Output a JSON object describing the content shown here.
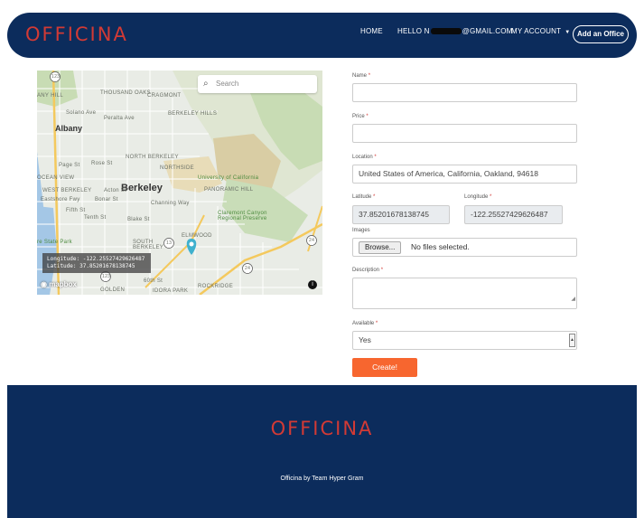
{
  "nav": {
    "brand": "OFFICINA",
    "home": "HOME",
    "hello_prefix": "HELLO N",
    "hello_suffix": "@GMAIL.COM",
    "my_account": "MY ACCOUNT",
    "add_office": "Add an Office"
  },
  "map": {
    "search_placeholder": "Search",
    "longitude_readout": "Longitude: -122.25527429626487",
    "latitude_readout": "Latitude: 37.85201678138745",
    "attribution_logo": "mapbox",
    "labels": {
      "berkeley": "Berkeley",
      "albany": "Albany",
      "north_berkeley": "NORTH BERKELEY",
      "northside": "NORTHSIDE",
      "thousand_oaks": "THOUSAND OAKS",
      "cragmont": "CRAGMONT",
      "berkeley_hills": "BERKELEY HILLS",
      "university": "University of California",
      "panoramic_hill": "PANORAMIC HILL",
      "claremont_canyon": "Claremont Canyon Regional Preserve",
      "west_berkeley": "WEST BERKELEY",
      "ocean_view": "OCEAN VIEW",
      "south_berkeley": "SOUTH BERKELEY",
      "elmwood": "ELMWOOD",
      "rockridge": "ROCKRIDGE",
      "golden": "GOLDEN",
      "idora_park": "IDORA PARK",
      "state_park": "re State Park",
      "any_hill": "ANY HILL",
      "solano_ave": "Solano Ave",
      "page_st": "Page St",
      "rose_st": "Rose St",
      "channing_way": "Channing Way",
      "blake_st": "Blake St",
      "sixtieth_st": "60th St",
      "fifth_st": "Fifth St",
      "tenth_st": "Tenth St",
      "bonar_st": "Bonar St",
      "acton_st": "Acton St",
      "eastshore_fwy": "Eastshore Fwy",
      "peralta_ave": "Peralta Ave",
      "route_123a": "123",
      "route_123b": "123",
      "route_13": "13",
      "route_24a": "24",
      "route_24b": "24"
    }
  },
  "form": {
    "name_label": "Name",
    "price_label": "Price",
    "location_label": "Location",
    "location_value": "United States of America, California, Oakland, 94618",
    "latitude_label": "Latitude",
    "latitude_value": "37.85201678138745",
    "longitude_label": "Longitude",
    "longitude_value": "-122.25527429626487",
    "images_label": "Images",
    "browse_label": "Browse...",
    "no_file_text": "No files selected.",
    "description_label": "Description",
    "available_label": "Available",
    "available_value": "Yes",
    "required_marker": "*",
    "create_label": "Create!"
  },
  "footer": {
    "brand": "OFFICINA",
    "credit": "Officina by Team Hyper Gram"
  },
  "colors": {
    "navy": "#0c2c5c",
    "brand_red": "#d23a35",
    "create_orange": "#f7662f"
  }
}
